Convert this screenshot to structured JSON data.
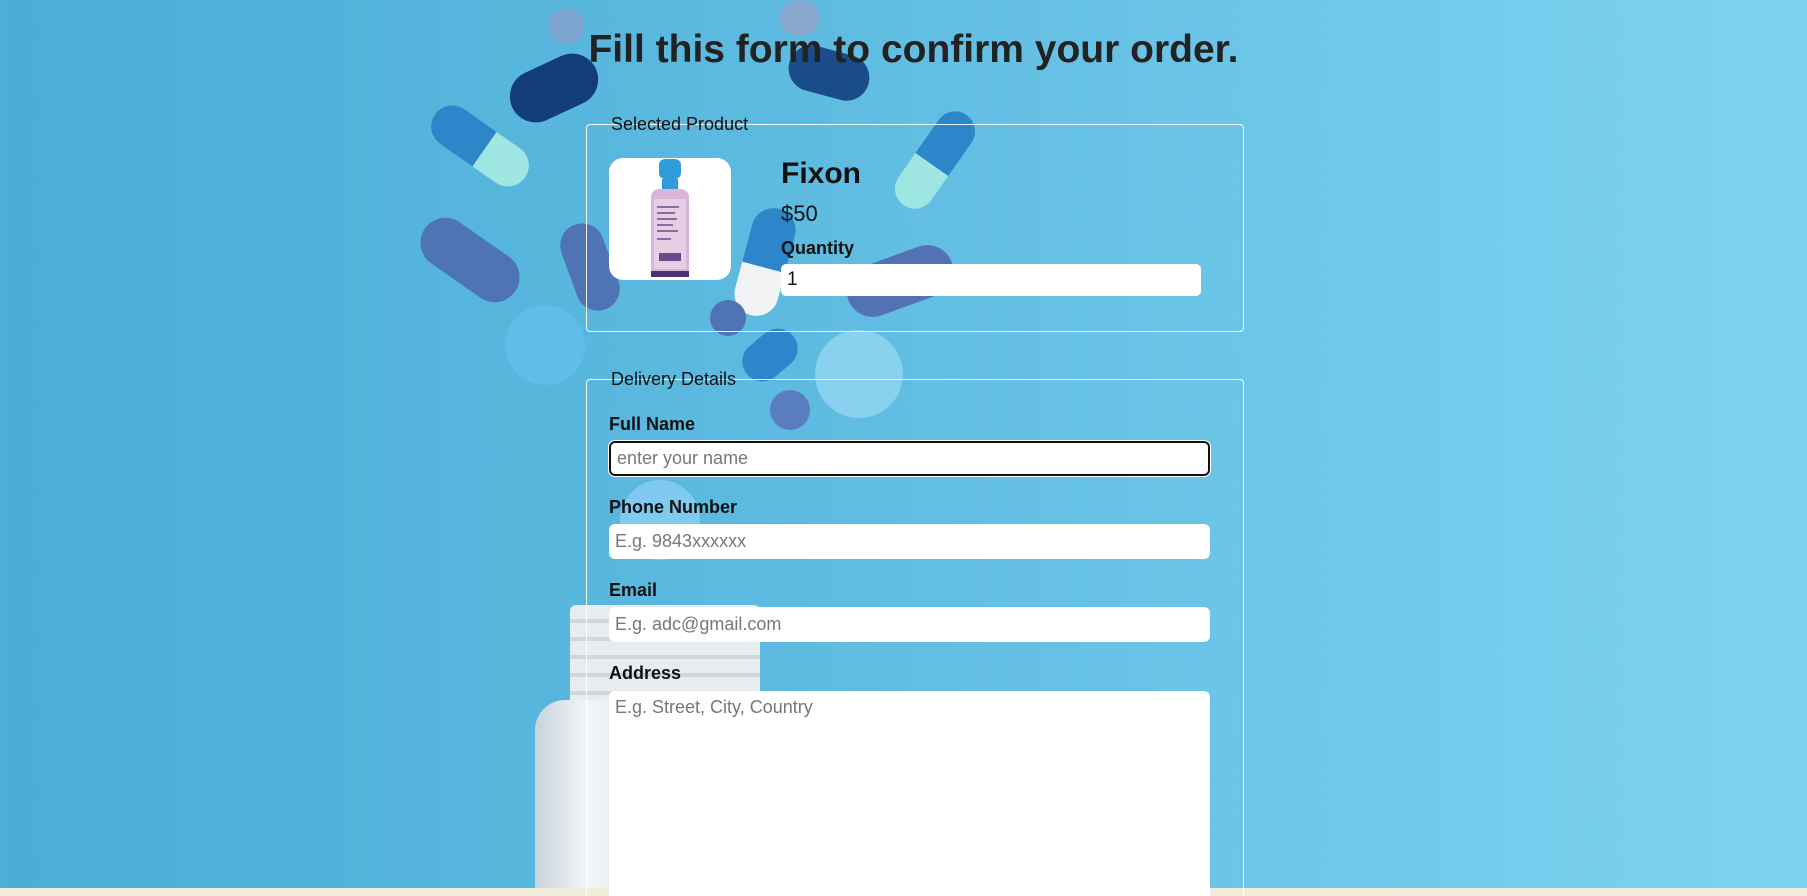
{
  "page": {
    "title": "Fill this form to confirm your order."
  },
  "product_section": {
    "legend": "Selected Product",
    "product": {
      "name": "Fixon",
      "price": "$50",
      "image_icon": "medicine-bottle-icon"
    },
    "quantity": {
      "label": "Quantity",
      "value": "1"
    }
  },
  "delivery_section": {
    "legend": "Delivery Details",
    "full_name": {
      "label": "Full Name",
      "placeholder": "enter your name",
      "value": ""
    },
    "phone": {
      "label": "Phone Number",
      "placeholder": "E.g. 9843xxxxxx",
      "value": ""
    },
    "email": {
      "label": "Email",
      "placeholder": "E.g. adc@gmail.com",
      "value": ""
    },
    "address": {
      "label": "Address",
      "placeholder": "E.g. Street, City, Country",
      "value": ""
    }
  },
  "colors": {
    "background": "#5cb9df",
    "title_text": "#222222",
    "fieldset_border": "#ffffff",
    "input_background": "#ffffff"
  }
}
